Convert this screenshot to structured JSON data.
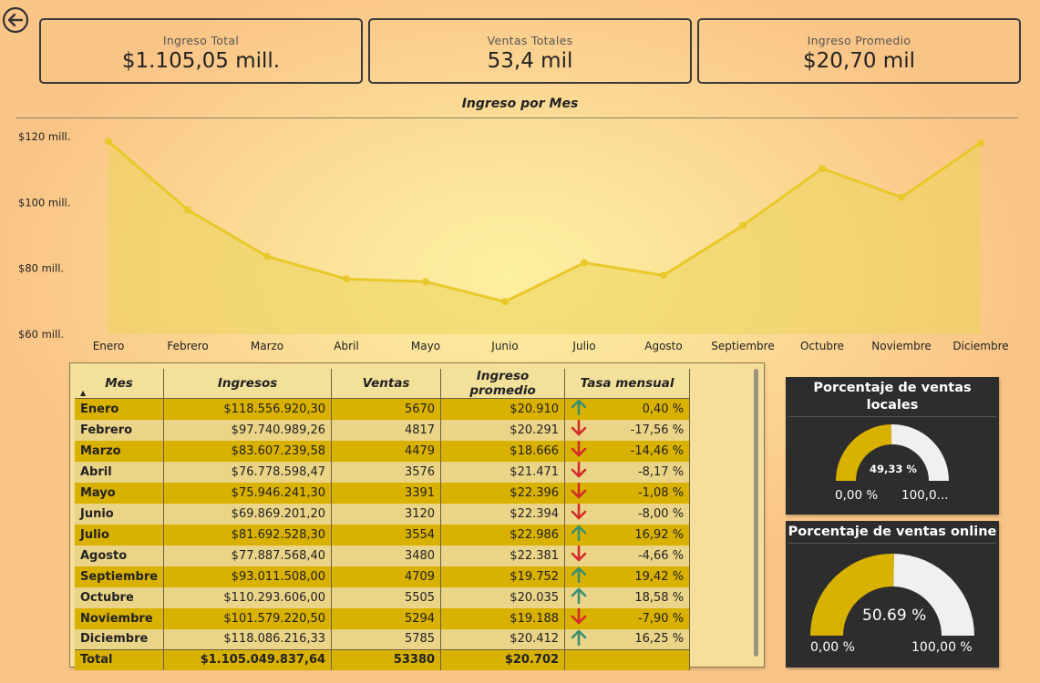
{
  "kpis": [
    {
      "label": "Ingreso Total",
      "value": "$1.105,05 mill."
    },
    {
      "label": "Ventas Totales",
      "value": "53,4 mil"
    },
    {
      "label": "Ingreso Promedio",
      "value": "$20,70 mil"
    }
  ],
  "back_icon": "arrow-left-circle-icon",
  "colors": {
    "accent": "#d9b100",
    "line": "#e8c82a",
    "area": "#ecd35a",
    "gauge_bg": "#2d2d2d",
    "up": "#3a8f6e",
    "down": "#d42b2b"
  },
  "chart_data": {
    "type": "area",
    "title": "Ingreso por Mes",
    "categories": [
      "Enero",
      "Febrero",
      "Marzo",
      "Abril",
      "Mayo",
      "Junio",
      "Julio",
      "Agosto",
      "Septiembre",
      "Octubre",
      "Noviembre",
      "Diciembre"
    ],
    "values": [
      118.56,
      97.74,
      83.61,
      76.78,
      75.95,
      69.87,
      81.69,
      77.89,
      93.01,
      110.29,
      101.58,
      118.09
    ],
    "ylim": [
      60,
      120
    ],
    "yticks": [
      {
        "v": 120,
        "label": "$120 mill."
      },
      {
        "v": 100,
        "label": "$100 mill."
      },
      {
        "v": 80,
        "label": "$80 mill."
      },
      {
        "v": 60,
        "label": "$60 mill."
      }
    ],
    "xlabel": "",
    "ylabel": ""
  },
  "table": {
    "headers": [
      "Mes",
      "Ingresos",
      "Ventas",
      "Ingreso promedio",
      "Tasa mensual"
    ],
    "rows": [
      {
        "mes": "Enero",
        "ingresos": "$118.556.920,30",
        "ventas": "5670",
        "promedio": "$20.910",
        "dir": "up",
        "tasa": "0,40 %"
      },
      {
        "mes": "Febrero",
        "ingresos": "$97.740.989,26",
        "ventas": "4817",
        "promedio": "$20.291",
        "dir": "down",
        "tasa": "-17,56 %"
      },
      {
        "mes": "Marzo",
        "ingresos": "$83.607.239,58",
        "ventas": "4479",
        "promedio": "$18.666",
        "dir": "down",
        "tasa": "-14,46 %"
      },
      {
        "mes": "Abril",
        "ingresos": "$76.778.598,47",
        "ventas": "3576",
        "promedio": "$21.471",
        "dir": "down",
        "tasa": "-8,17 %"
      },
      {
        "mes": "Mayo",
        "ingresos": "$75.946.241,30",
        "ventas": "3391",
        "promedio": "$22.396",
        "dir": "down",
        "tasa": "-1,08 %"
      },
      {
        "mes": "Junio",
        "ingresos": "$69.869.201,20",
        "ventas": "3120",
        "promedio": "$22.394",
        "dir": "down",
        "tasa": "-8,00 %"
      },
      {
        "mes": "Julio",
        "ingresos": "$81.692.528,30",
        "ventas": "3554",
        "promedio": "$22.986",
        "dir": "up",
        "tasa": "16,92 %"
      },
      {
        "mes": "Agosto",
        "ingresos": "$77.887.568,40",
        "ventas": "3480",
        "promedio": "$22.381",
        "dir": "down",
        "tasa": "-4,66 %"
      },
      {
        "mes": "Septiembre",
        "ingresos": "$93.011.508,00",
        "ventas": "4709",
        "promedio": "$19.752",
        "dir": "up",
        "tasa": "19,42 %"
      },
      {
        "mes": "Octubre",
        "ingresos": "$110.293.606,00",
        "ventas": "5505",
        "promedio": "$20.035",
        "dir": "up",
        "tasa": "18,58 %"
      },
      {
        "mes": "Noviembre",
        "ingresos": "$101.579.220,50",
        "ventas": "5294",
        "promedio": "$19.188",
        "dir": "down",
        "tasa": "-7,90 %"
      },
      {
        "mes": "Diciembre",
        "ingresos": "$118.086.216,33",
        "ventas": "5785",
        "promedio": "$20.412",
        "dir": "up",
        "tasa": "16,25 %"
      }
    ],
    "total": {
      "mes": "Total",
      "ingresos": "$1.105.049.837,64",
      "ventas": "53380",
      "promedio": "$20.702"
    }
  },
  "gauges": [
    {
      "title": "Porcentaje de ventas locales",
      "value_label": "49,33 %",
      "min_label": "0,00 %",
      "max_label": "100,0...",
      "fraction": 0.4933
    },
    {
      "title": "Porcentaje de ventas online",
      "value_label": "50.69 %",
      "min_label": "0,00 %",
      "max_label": "100,00 %",
      "fraction": 0.5069
    }
  ]
}
